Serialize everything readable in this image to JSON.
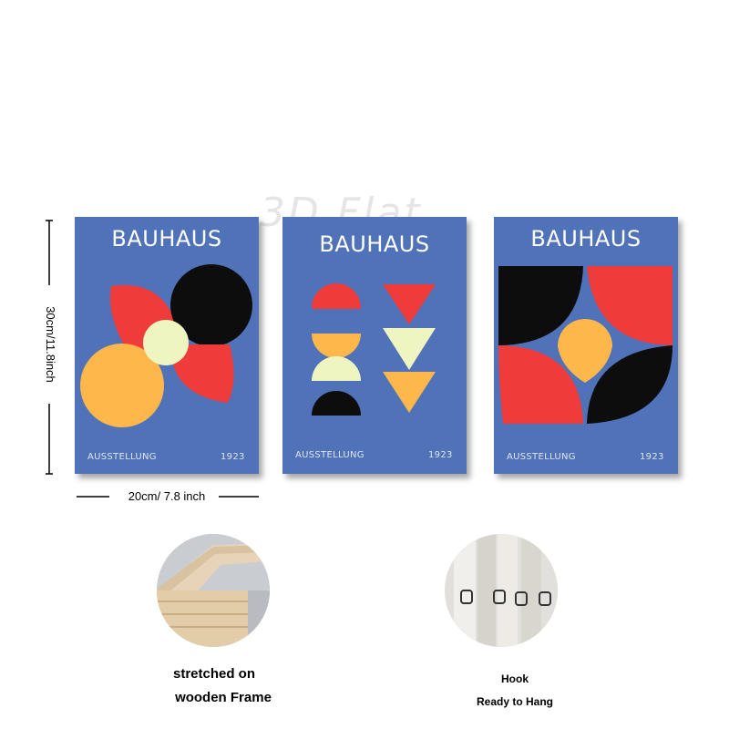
{
  "watermark": "3D Flat",
  "panels": [
    {
      "title": "BAUHAUS",
      "footer_left": "AUSSTELLUNG",
      "footer_right": "1923"
    },
    {
      "title": "BAUHAUS",
      "footer_left": "AUSSTELLUNG",
      "footer_right": "1923"
    },
    {
      "title": "BAUHAUS",
      "footer_left": "AUSSTELLUNG",
      "footer_right": "1923"
    }
  ],
  "dimensions": {
    "height_label": "30cm/11.8inch",
    "width_label": "20cm/ 7.8 inch"
  },
  "features": [
    {
      "line1": "stretched on",
      "line2": "wooden Frame"
    },
    {
      "line1": "Hook",
      "line2": "Ready to Hang"
    }
  ],
  "colors": {
    "panel_blue": "#4f72b8",
    "red": "#f03b3b",
    "black": "#0d0d0d",
    "yellow": "#fdb74b",
    "cream": "#eef5c0"
  }
}
